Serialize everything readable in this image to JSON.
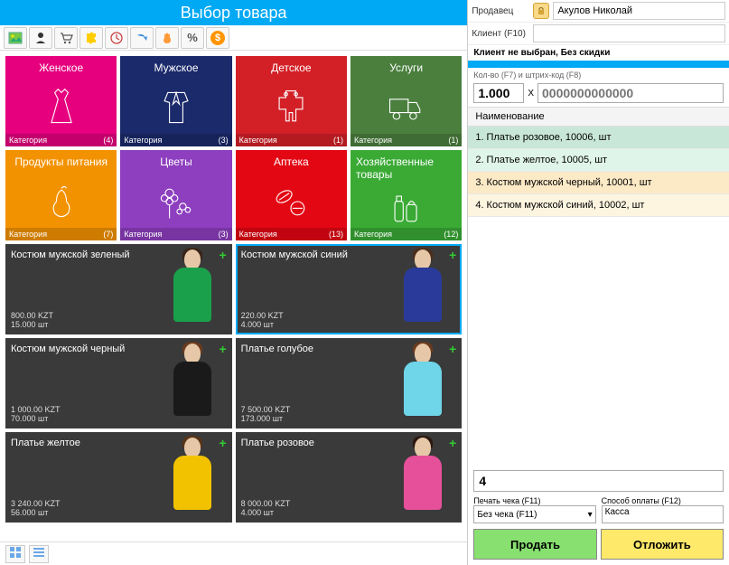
{
  "title": "Выбор товара",
  "toolbar_icons": [
    "picture",
    "person",
    "cart",
    "puzzle",
    "clock",
    "arrow",
    "hand",
    "percent",
    "dollar"
  ],
  "categories": [
    {
      "name": "Женское",
      "count": "(4)",
      "color": "#e6007e",
      "icon": "dress"
    },
    {
      "name": "Мужское",
      "count": "(3)",
      "color": "#1b2a6b",
      "icon": "suit"
    },
    {
      "name": "Детское",
      "count": "(1)",
      "color": "#d32027",
      "icon": "baby"
    },
    {
      "name": "Услуги",
      "count": "(1)",
      "color": "#4a7f3e",
      "icon": "truck"
    },
    {
      "name": "Продукты питания",
      "count": "(7)",
      "color": "#f39200",
      "icon": "pear"
    },
    {
      "name": "Цветы",
      "count": "(3)",
      "color": "#8d3fbf",
      "icon": "flower"
    },
    {
      "name": "Аптека",
      "count": "(13)",
      "color": "#e30613",
      "icon": "pills"
    },
    {
      "name": "Хозяйственные товары",
      "count": "(12)",
      "color": "#3aaa35",
      "icon": "bottles"
    }
  ],
  "cat_footer_label": "Категория",
  "products": [
    {
      "name": "Костюм мужской зеленый",
      "price": "800.00 KZT",
      "stock": "15.000 шт",
      "color": "#1aa04a",
      "hair": "#3a2418"
    },
    {
      "name": "Костюм мужской синий",
      "price": "220.00 KZT",
      "stock": "4.000 шт",
      "color": "#2a3a9a",
      "hair": "#4a2d1a",
      "selected": true
    },
    {
      "name": "Костюм мужской черный",
      "price": "1 000.00 KZT",
      "stock": "70.000 шт",
      "color": "#1a1a1a",
      "hair": "#6b3a1e"
    },
    {
      "name": "Платье голубое",
      "price": "7 500.00 KZT",
      "stock": "173.000 шт",
      "color": "#6fd5e8",
      "hair": "#6b3a1e"
    },
    {
      "name": "Платье желтое",
      "price": "3 240.00 KZT",
      "stock": "56.000 шт",
      "color": "#f2c200",
      "hair": "#5a3418"
    },
    {
      "name": "Платье розовое",
      "price": "8 000.00 KZT",
      "stock": "4.000 шт",
      "color": "#e6509a",
      "hair": "#2a1810"
    }
  ],
  "seller_label": "Продавец",
  "seller_value": "Акулов Николай",
  "client_label": "Клиент (F10)",
  "client_value": "",
  "client_status": "Клиент не выбран, Без скидки",
  "qty_hint": "Кол-во (F7) и штрих-код (F8)",
  "qty_value": "1.000",
  "qty_mult": "X",
  "barcode_placeholder": "0000000000000",
  "list_header": "Наименование",
  "list_items": [
    "1. Платье розовое, 10006, шт",
    "2. Платье желтое, 10005, шт",
    "3. Костюм мужской черный, 10001, шт",
    "4. Костюм мужской синий, 10002, шт"
  ],
  "search_value": "4",
  "receipt_label": "Печать чека (F11)",
  "receipt_value": "Без чека (F11)",
  "payment_label": "Способ оплаты (F12)",
  "payment_value": "Касса",
  "btn_sell": "Продать",
  "btn_hold": "Отложить"
}
